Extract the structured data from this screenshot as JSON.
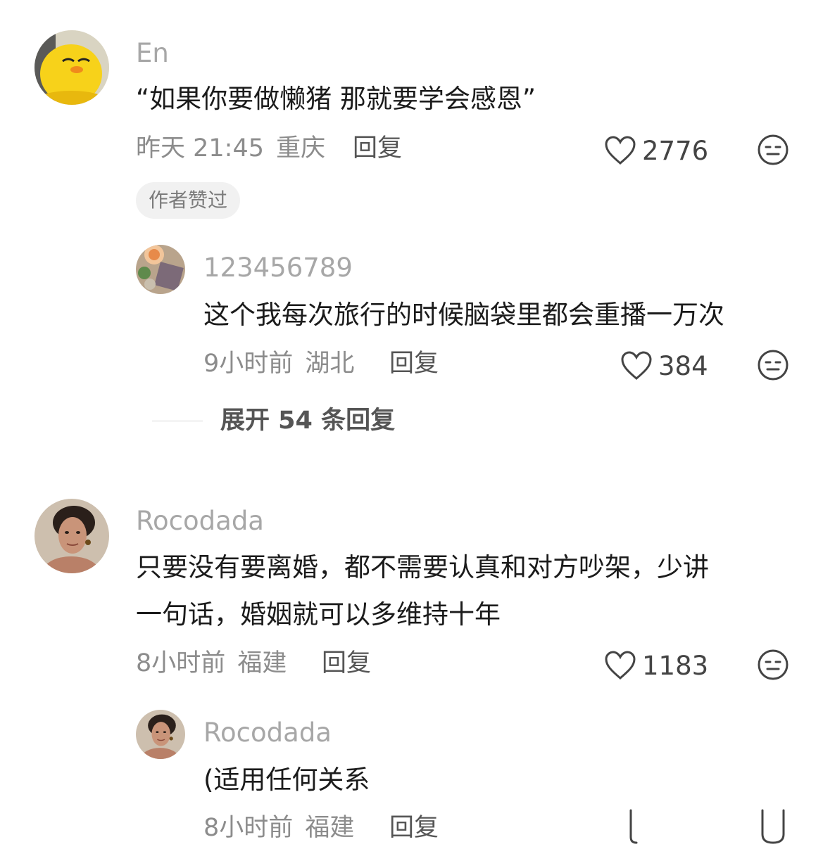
{
  "comments": [
    {
      "username": "En",
      "text": "“如果你要做懒猪 那就要学会感恩”",
      "time": "昨天 21:45",
      "location": "重庆",
      "reply_label": "回复",
      "likes": "2776",
      "badge": "作者赞过",
      "avatar_icon": "yellow-duck-avatar",
      "replies": [
        {
          "username": "123456789",
          "text": "这个我每次旅行的时候脑袋里都会重播一万次",
          "time": "9小时前",
          "location": "湖北",
          "reply_label": "回复",
          "likes": "384",
          "avatar_icon": "food-photo-avatar"
        }
      ],
      "expand_label": "展开 54 条回复"
    },
    {
      "username": "Rocodada",
      "text_line1": "只要没有要离婚，都不需要认真和对方吵架，少讲",
      "text_line2": "一句话，婚姻就可以多维持十年",
      "time": "8小时前",
      "location": "福建",
      "reply_label": "回复",
      "likes": "1183",
      "avatar_icon": "woman-portrait-avatar",
      "replies": [
        {
          "username": "Rocodada",
          "text": "(适用任何关系",
          "time": "8小时前",
          "location": "福建",
          "reply_label": "回复",
          "avatar_icon": "woman-portrait-avatar"
        }
      ]
    }
  ],
  "icons": {
    "like": "heart-outline-icon",
    "dislike": "meh-face-icon"
  },
  "colors": {
    "username": "#a7a7a7",
    "text": "#1b1b1b",
    "meta": "#8c8c8c",
    "badge_bg": "#f1f1f1"
  }
}
